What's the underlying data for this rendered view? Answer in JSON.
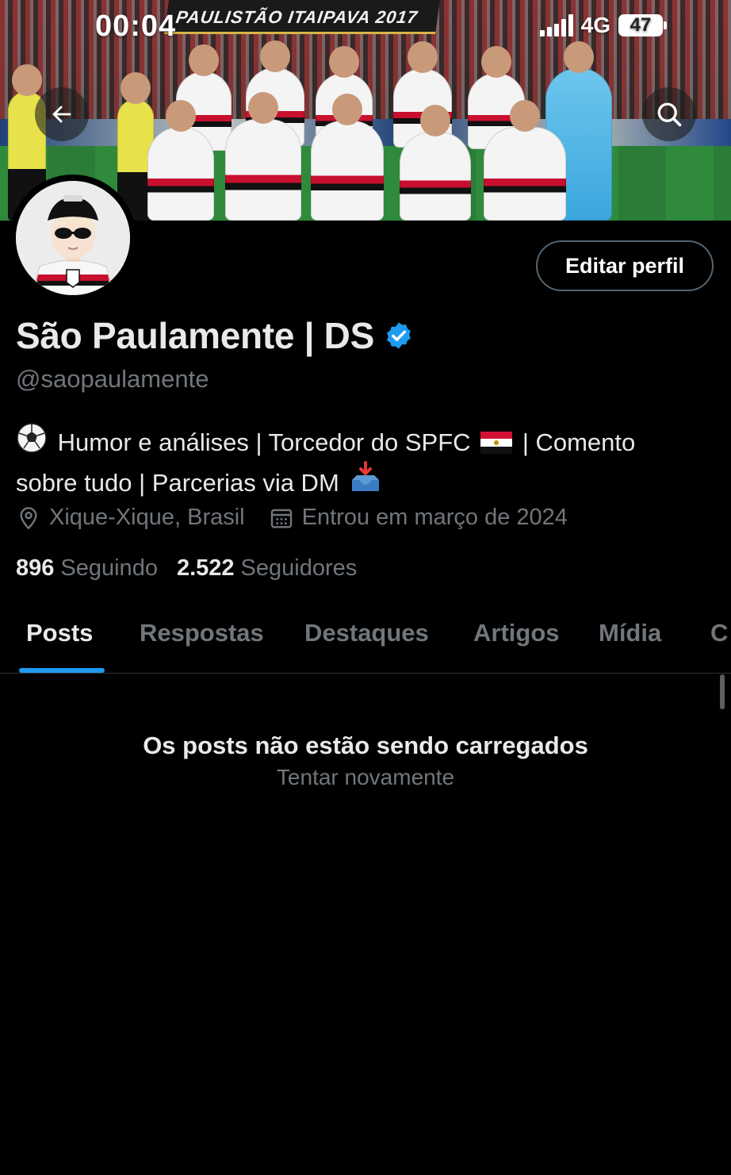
{
  "status_bar": {
    "time": "00:04",
    "network": "4G",
    "battery": "47"
  },
  "banner": {
    "title_text": "PAULISTÃO ITAIPAVA 2017"
  },
  "header": {
    "back_icon": "arrow-left-icon",
    "search_icon": "search-icon"
  },
  "profile": {
    "display_name": "São Paulamente | DS",
    "handle": "@saopaulamente",
    "edit_button_label": "Editar perfil",
    "verified_color": "#1d9bf0",
    "bio_line1_text_a": "Humor e análises | Torcedor do SPFC",
    "bio_line1_text_b": "| Comento",
    "bio_line2_text": "sobre tudo | Parcerias via DM",
    "bio_emojis": [
      "soccer-ball",
      "flag-tricolor",
      "inbox-tray"
    ],
    "location": "Xique-Xique, Brasil",
    "joined": "Entrou em março de 2024",
    "following_count": "896",
    "following_label": "Seguindo",
    "followers_count": "2.522",
    "followers_label": "Seguidores"
  },
  "tabs": [
    {
      "label": "Posts",
      "active": true
    },
    {
      "label": "Respostas",
      "active": false
    },
    {
      "label": "Destaques",
      "active": false
    },
    {
      "label": "Artigos",
      "active": false
    },
    {
      "label": "Mídia",
      "active": false
    },
    {
      "label": "C",
      "active": false
    }
  ],
  "feed": {
    "empty_title": "Os posts não estão sendo carregados",
    "retry_label": "Tentar novamente"
  },
  "colors": {
    "background": "#000000",
    "accent": "#1d9bf0",
    "muted_text": "#71767b",
    "primary_text": "#e7e9ea"
  }
}
